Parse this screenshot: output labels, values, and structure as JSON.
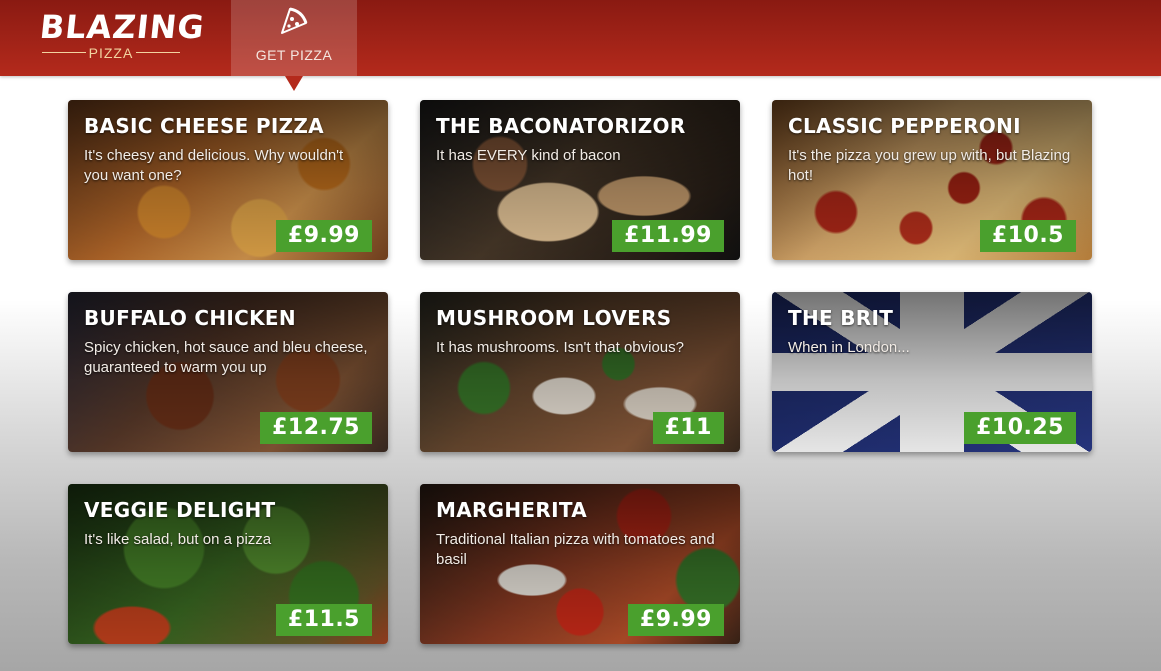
{
  "brand": {
    "name": "BLAZING",
    "sub": "PIZZA"
  },
  "nav": {
    "tab_label": "GET PIZZA",
    "tab_icon": "pizza-slice-icon"
  },
  "colors": {
    "header": "#a32216",
    "price_badge": "#4aa02d"
  },
  "specials": [
    {
      "title": "BASIC CHEESE PIZZA",
      "description": "It's cheesy and delicious. Why wouldn't you want one?",
      "price": "£9.99"
    },
    {
      "title": "THE BACONATORIZOR",
      "description": "It has EVERY kind of bacon",
      "price": "£11.99"
    },
    {
      "title": "CLASSIC PEPPERONI",
      "description": "It's the pizza you grew up with, but Blazing hot!",
      "price": "£10.5"
    },
    {
      "title": "BUFFALO CHICKEN",
      "description": "Spicy chicken, hot sauce and bleu cheese, guaranteed to warm you up",
      "price": "£12.75"
    },
    {
      "title": "MUSHROOM LOVERS",
      "description": "It has mushrooms. Isn't that obvious?",
      "price": "£11"
    },
    {
      "title": "THE BRIT",
      "description": "When in London...",
      "price": "£10.25"
    },
    {
      "title": "VEGGIE DELIGHT",
      "description": "It's like salad, but on a pizza",
      "price": "£11.5"
    },
    {
      "title": "MARGHERITA",
      "description": "Traditional Italian pizza with tomatoes and basil",
      "price": "£9.99"
    }
  ]
}
